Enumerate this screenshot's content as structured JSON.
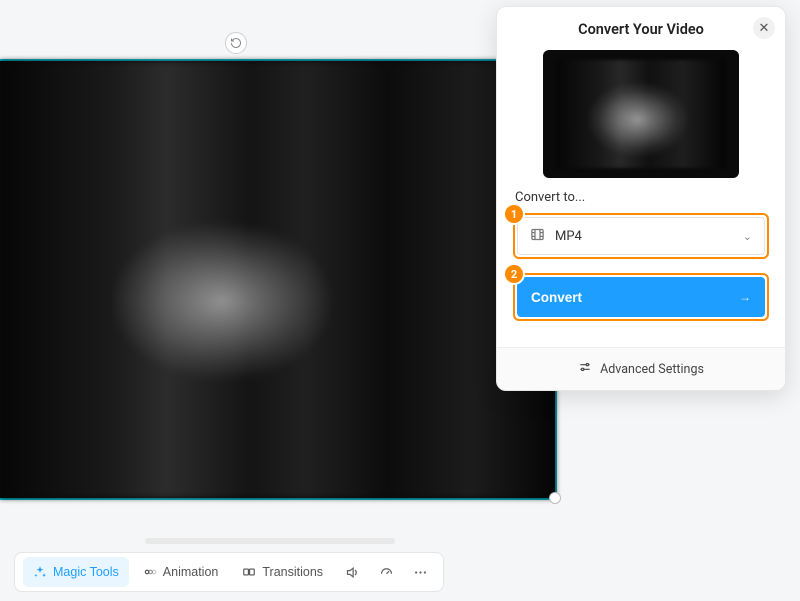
{
  "toolbar": {
    "magic_tools": "Magic Tools",
    "animation": "Animation",
    "transitions": "Transitions"
  },
  "modal": {
    "title": "Convert Your Video",
    "convert_to_label": "Convert to...",
    "format_selected": "MP4",
    "convert_button": "Convert",
    "advanced_settings": "Advanced Settings"
  },
  "steps": {
    "one": "1",
    "two": "2"
  }
}
